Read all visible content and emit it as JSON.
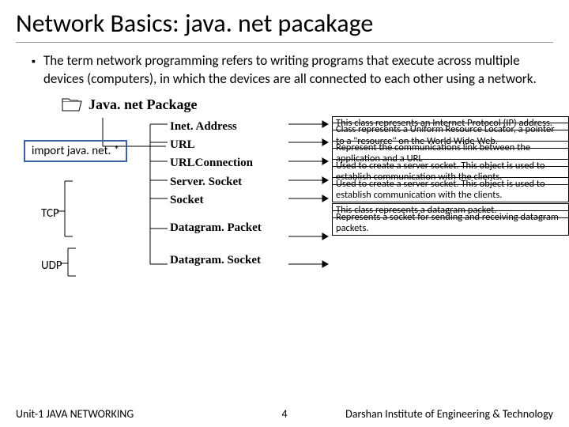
{
  "title": "Network Basics: java. net pacakage",
  "bullet": "The term network programming refers to writing programs that execute across multiple devices (computers), in which the devices are all connected to each other using a network.",
  "package_header": "Java. net Package",
  "import_label": "import java. net. *",
  "protocols": {
    "tcp": "TCP",
    "udp": "UDP"
  },
  "classes": {
    "inet": "Inet. Address",
    "url": "URL",
    "urlconn": "URLConnection",
    "server": "Server. Socket",
    "socket": "Socket",
    "dpacket": "Datagram. Packet",
    "dsocket": "Datagram. Socket"
  },
  "descs": {
    "inet": "This class represents an Internet Protocol (IP) address.",
    "url": "Class represents a Uniform Resource Locator, a pointer to a \"resource\" on the World Wide Web.",
    "urlconn": "Represent the communications link between the application and a URL",
    "server": "Used to create a server socket. This object is used to establish communication with the clients.",
    "socket": "Used to create a server socket. This object is used to establish communication with the clients.",
    "dpacket": "This class represents a datagram packet.",
    "dsocket": "Represents a socket for sending and receiving datagram packets."
  },
  "footer": {
    "left": "Unit-1 JAVA NETWORKING",
    "page": "4",
    "right": "Darshan Institute of Engineering & Technology"
  }
}
